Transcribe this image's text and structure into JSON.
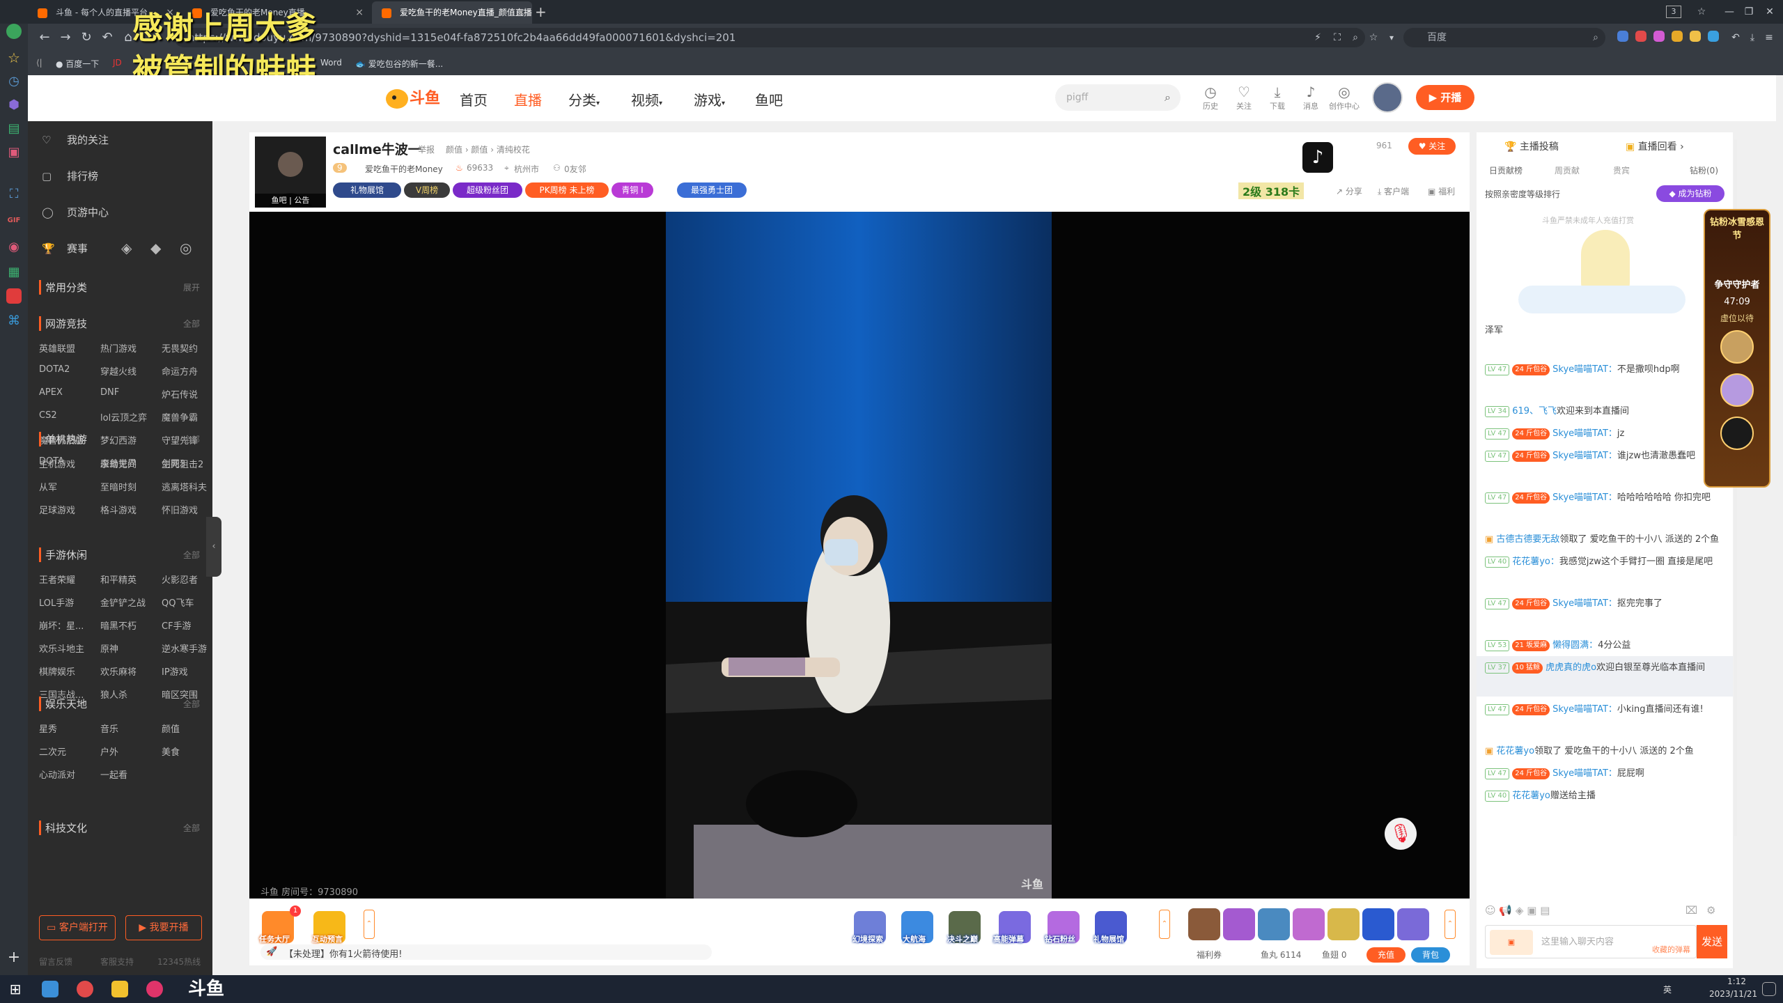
{
  "browser": {
    "tabs": [
      {
        "label": "斗鱼 - 每个人的直播平台"
      },
      {
        "label": "爱吃鱼干的老Money直播"
      },
      {
        "label": "爱吃鱼干的老Money直播_颜值直播"
      }
    ],
    "url": "https://www.douyu.com/9730890?dyshid=1315e04f-fa872510fc2b4aa66dd49fa000071601&dyshci=201",
    "search_engine": "百度",
    "bookmarks": [
      "百度一下",
      "Word",
      "爱吃包谷的新一餐..."
    ],
    "tab_count": "3"
  },
  "overlay": {
    "line1": "感谢上周大爹",
    "line2": "被管制的蛙蛙"
  },
  "header": {
    "nav": [
      "首页",
      "直播",
      "分类",
      "视频",
      "游戏",
      "鱼吧"
    ],
    "search_placeholder": "pigff",
    "icons": [
      "历史",
      "关注",
      "下载",
      "消息",
      "创作中心"
    ],
    "open_live": "开播"
  },
  "sidebar": {
    "top_items": [
      "我的关注",
      "排行榜",
      "页游中心",
      "赛事"
    ],
    "common_title": "常用分类",
    "common_expand": "展开",
    "sections": [
      {
        "title": "网游竞技",
        "all": "全部",
        "items": [
          "英雄联盟",
          "热门游戏",
          "无畏契约",
          "DOTA2",
          "穿越火线",
          "命运方舟",
          "APEX",
          "DNF",
          "炉石传说",
          "CS2",
          "lol云顶之弈",
          "魔兽争霸",
          "魔兽怀旧服",
          "梦幻西游",
          "守望先锋",
          "DOTA",
          "魔兽世界",
          "剑网3"
        ]
      },
      {
        "title": "单机热游",
        "all": "全部",
        "items": [
          "主机游戏",
          "永劫无间",
          "生死狙击2",
          "从军",
          "至暗时刻",
          "逃离塔科夫",
          "足球游戏",
          "格斗游戏",
          "怀旧游戏"
        ]
      },
      {
        "title": "手游休闲",
        "all": "全部",
        "items": [
          "王者荣耀",
          "和平精英",
          "火影忍者",
          "LOL手游",
          "金铲铲之战",
          "QQ飞车",
          "崩坏：星...",
          "暗黑不朽",
          "CF手游",
          "欢乐斗地主",
          "原神",
          "逆水寒手游",
          "棋牌娱乐",
          "欢乐麻将",
          "IP游戏",
          "三国志战...",
          "狼人杀",
          "暗区突围"
        ]
      },
      {
        "title": "娱乐天地",
        "all": "全部",
        "items": [
          "星秀",
          "音乐",
          "颜值",
          "二次元",
          "户外",
          "美食",
          "心动派对",
          "一起看"
        ]
      },
      {
        "title": "科技文化",
        "all": "全部",
        "items": []
      }
    ],
    "client_btn": "客户端打开",
    "open_btn": "我要开播",
    "footer": [
      "留言反馈",
      "客服支持",
      "12345热线"
    ]
  },
  "room": {
    "streamer": "callme牛波一",
    "report": "举报",
    "category": "颜值 › 颜值 › 清纯校花",
    "level": "9",
    "owner": "爱吃鱼干的老Money",
    "heat": "69633",
    "location": "杭州市",
    "friends": "0友邻",
    "avatar_tags": [
      "鱼吧",
      "公告"
    ],
    "pills": [
      "礼物展馆",
      "V周榜",
      "超级粉丝团",
      "PK周榜 未上榜",
      "青铜 I",
      "最强勇士团"
    ],
    "follow_count": "961",
    "follow": "关注",
    "level_banner": "2级 318卡",
    "actions": [
      "分享",
      "客户端",
      "福利"
    ],
    "room_no": "斗鱼 房间号：9730890",
    "watermark": "斗鱼"
  },
  "toolbar": {
    "left": [
      "任务大厅",
      "互动预言"
    ],
    "task_badge": "1",
    "notice": "【未处理】你有1火箭待使用!",
    "gifts": [
      "幻境探索",
      "大航海",
      "决斗之巅",
      "高能弹幕",
      "钻石粉丝",
      "礼物展馆"
    ],
    "bottom": [
      "福利券",
      "鱼丸 6114",
      "鱼翅 0"
    ],
    "recharge": "充值",
    "bag": "背包"
  },
  "chat": {
    "tabs": [
      "主播投稿",
      "直播回看"
    ],
    "subtabs": [
      "日贡献榜",
      "周贡献",
      "贵宾",
      "钻粉(0)"
    ],
    "rank_hint": "按照亲密度等级排行",
    "become_fan": "成为钻粉",
    "minor_hint": "斗鱼严禁未成年人充值打赏",
    "messages": [
      {
        "lv": "LV 47",
        "badge": "24 斤包谷",
        "name": "Skye喵喵TAT：",
        "text": "不是撒呗hdp啊"
      },
      {
        "lv": "LV 34",
        "badge": "",
        "name": "619、飞飞",
        "text": "欢迎来到本直播间"
      },
      {
        "lv": "LV 47",
        "badge": "24 斤包谷",
        "name": "Skye喵喵TAT：",
        "text": "jz"
      },
      {
        "lv": "LV 47",
        "badge": "24 斤包谷",
        "name": "Skye喵喵TAT：",
        "text": "谁jzw也清澈愚蠢吧"
      },
      {
        "lv": "LV 47",
        "badge": "24 斤包谷",
        "name": "Skye喵喵TAT：",
        "text": "哈哈哈哈哈哈 你扣完吧"
      },
      {
        "lv": "",
        "badge": "",
        "name": "古德古德要无敌",
        "text": "领取了 爱吃鱼干的十小八 派送的 2个鱼"
      },
      {
        "lv": "LV 40",
        "badge": "",
        "name": "花花薯yo：",
        "text": "我感觉jzw这个手臂打一圈 直接是尾吧"
      },
      {
        "lv": "LV 47",
        "badge": "24 斤包谷",
        "name": "Skye喵喵TAT：",
        "text": "抠完完事了"
      },
      {
        "lv": "LV 53",
        "badge": "21 坂爱麻",
        "name": "懒得圆满：",
        "text": "4分公益"
      },
      {
        "lv": "LV 37",
        "badge": "10 猛鲸",
        "name": "虎虎真的虎o",
        "text": "欢迎白银至尊光临本直播间"
      },
      {
        "lv": "LV 47",
        "badge": "24 斤包谷",
        "name": "Skye喵喵TAT：",
        "text": "小king直播间还有谁!"
      },
      {
        "lv": "",
        "badge": "",
        "name": "花花薯yo",
        "text": "领取了 爱吃鱼干的十小八 派送的 2个鱼"
      },
      {
        "lv": "LV 47",
        "badge": "24 斤包谷",
        "name": "Skye喵喵TAT：",
        "text": "屁屁啊"
      },
      {
        "lv": "LV 40",
        "badge": "",
        "name": "花花薯yo",
        "text": "赠送给主播"
      }
    ],
    "first_partial": "泽军",
    "input_placeholder": "这里输入聊天内容",
    "vip_hint": "收藏的弹幕",
    "send": "发送",
    "guard": {
      "title": "争守守护者",
      "timer": "47:09",
      "hint": "虚位以待",
      "banner": "钻粉冰雪感恩节"
    }
  },
  "taskbar": {
    "time": "1:12",
    "date": "2023/11/21",
    "lang": "英"
  }
}
